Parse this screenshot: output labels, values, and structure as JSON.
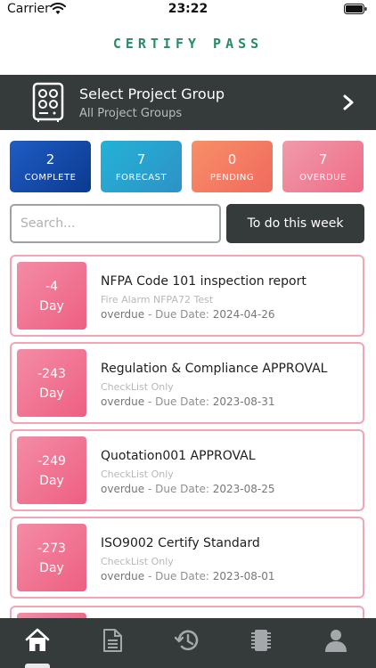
{
  "status_bar": {
    "carrier": "Carrier",
    "time": "23:22"
  },
  "app": {
    "logo_text": "CERTIFY PASS",
    "accent_color": "#2a8a63",
    "dark_color": "#353a3b"
  },
  "project_group": {
    "title": "Select Project Group",
    "subtitle": "All Project Groups"
  },
  "stats": {
    "complete": {
      "count": "2",
      "label": "COMPLETE"
    },
    "forecast": {
      "count": "7",
      "label": "FORECAST"
    },
    "pending": {
      "count": "0",
      "label": "PENDING"
    },
    "overdue": {
      "count": "7",
      "label": "OVERDUE"
    }
  },
  "search": {
    "placeholder": "Search...",
    "value": ""
  },
  "todo_button": {
    "label": "To do this week"
  },
  "tasks": [
    {
      "days": "-4",
      "day_label": "Day",
      "title": "NFPA Code 101 inspection report",
      "type": "Fire Alarm NFPA72 Test",
      "status": "overdue",
      "due_label": "- Due Date:",
      "due_date": "2024-04-26"
    },
    {
      "days": "-243",
      "day_label": "Day",
      "title": "Regulation & Compliance APPROVAL",
      "type": "CheckList Only",
      "status": "overdue",
      "due_label": "- Due Date:",
      "due_date": "2023-08-31"
    },
    {
      "days": "-249",
      "day_label": "Day",
      "title": "Quotation001 APPROVAL",
      "type": "CheckList Only",
      "status": "overdue",
      "due_label": "- Due Date:",
      "due_date": "2023-08-25"
    },
    {
      "days": "-273",
      "day_label": "Day",
      "title": "ISO9002 Certify Standard",
      "type": "CheckList Only",
      "status": "overdue",
      "due_label": "- Due Date:",
      "due_date": "2023-08-01"
    }
  ],
  "tab_bar": {
    "items": [
      {
        "icon": "home-icon",
        "active": true
      },
      {
        "icon": "document-icon",
        "active": false
      },
      {
        "icon": "history-icon",
        "active": false
      },
      {
        "icon": "chip-icon",
        "active": false
      },
      {
        "icon": "profile-icon",
        "active": false
      }
    ]
  }
}
